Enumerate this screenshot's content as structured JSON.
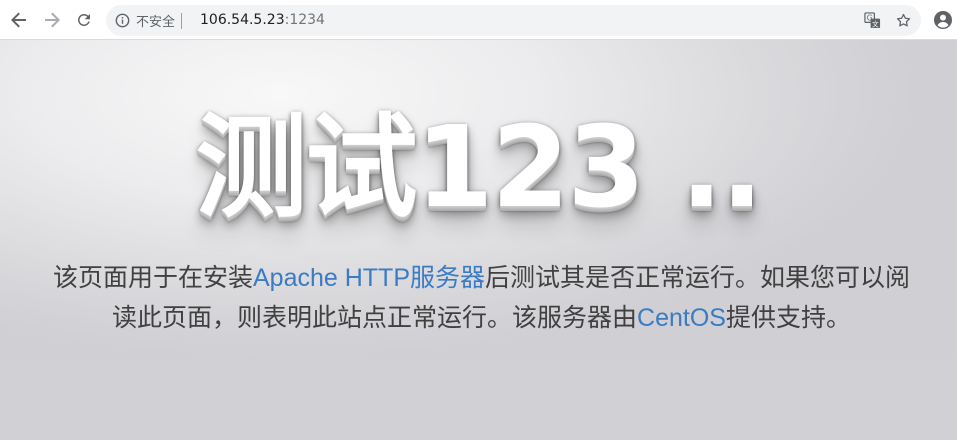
{
  "browser": {
    "address_bar": {
      "security_label": "不安全",
      "url_host": "106.54.5.23",
      "url_port": ":1234"
    },
    "icons": {
      "back": "back-arrow-icon",
      "forward": "forward-arrow-icon",
      "reload": "reload-icon",
      "info": "info-icon",
      "translate": "translate-icon",
      "bookmark": "star-icon",
      "profile": "account-icon"
    }
  },
  "page": {
    "heading": "测试123 ..",
    "lead": {
      "part1": "该页面用于在安装",
      "link1": "Apache HTTP服务器",
      "part2": "后测试其是否正常运行。如果您可以阅读此页面，则表明此站点正常运行。该服务器由",
      "link2": "CentOS",
      "part3": "提供支持。"
    },
    "colors": {
      "heading": "#ffffff",
      "text": "#404040",
      "link": "#3a7bc4"
    }
  }
}
